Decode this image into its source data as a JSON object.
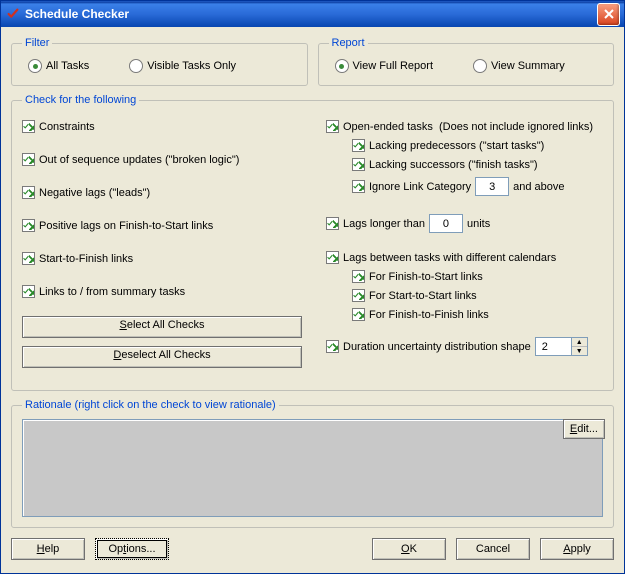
{
  "window": {
    "title": "Schedule Checker"
  },
  "filter": {
    "legend": "Filter",
    "all": "All Tasks",
    "visible": "Visible Tasks Only"
  },
  "report": {
    "legend": "Report",
    "full": "View Full Report",
    "summary": "View Summary"
  },
  "checks": {
    "legend": "Check for the following",
    "constraints": "Constraints",
    "oos": "Out of sequence updates (\"broken logic\")",
    "neglags": "Negative lags (\"leads\")",
    "poslags": "Positive lags on Finish-to-Start links",
    "stf": "Start-to-Finish links",
    "linkssummary": "Links to / from summary tasks",
    "openended": "Open-ended tasks  (Does not include ignored links)",
    "lackpred": "Lacking predecessors (\"start tasks\")",
    "lacksucc": "Lacking successors (\"finish tasks\")",
    "ignorecat_pre": "Ignore Link Category",
    "ignorecat_val": "3",
    "ignorecat_post": "and above",
    "lagslonger_pre": "Lags longer than",
    "lagslonger_val": "0",
    "lagslonger_post": "units",
    "lagscal": "Lags between tasks with different calendars",
    "for_fs": "For Finish-to-Start links",
    "for_ss": "For Start-to-Start links",
    "for_ff": "For Finish-to-Finish links",
    "duration_pre": "Duration uncertainty distribution shape",
    "duration_val": "2",
    "select_all": "Select All Checks",
    "deselect_all": "Deselect All Checks"
  },
  "rationale": {
    "legend": "Rationale (right click on the check to view rationale)",
    "edit": "Edit..."
  },
  "buttons": {
    "help": "Help",
    "options": "Options...",
    "ok": "OK",
    "cancel": "Cancel",
    "apply": "Apply"
  }
}
